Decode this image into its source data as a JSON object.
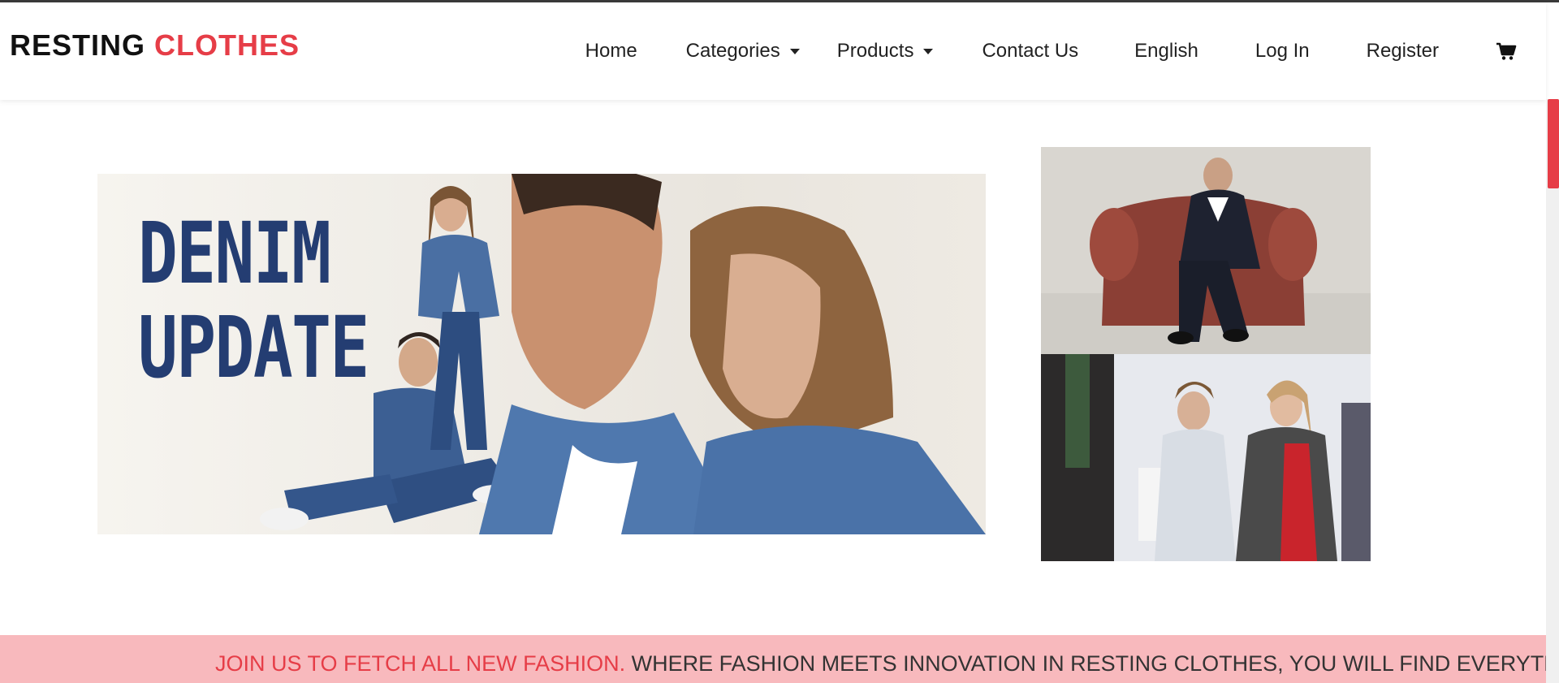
{
  "brand": {
    "part1": "RESTING ",
    "part2": "CLOTHES"
  },
  "nav": {
    "home": "Home",
    "categories": "Categories",
    "products": "Products",
    "contact": "Contact Us",
    "language": "English",
    "login": "Log In",
    "register": "Register"
  },
  "hero": {
    "line1": "DENIM",
    "line2": "UPDATE"
  },
  "marquee": {
    "highlight": "JOIN US TO FETCH ALL NEW FASHION.",
    "text": " WHERE FASHION MEETS INNOVATION IN RESTING CLOTHES, YOU WILL FIND EVERYTHING"
  },
  "colors": {
    "brand_accent": "#e63d47",
    "marquee_bg": "#f8b9bd",
    "denim_text": "#243d72"
  },
  "icons": {
    "cart": "shopping-cart-icon",
    "caret": "caret-down-icon"
  }
}
